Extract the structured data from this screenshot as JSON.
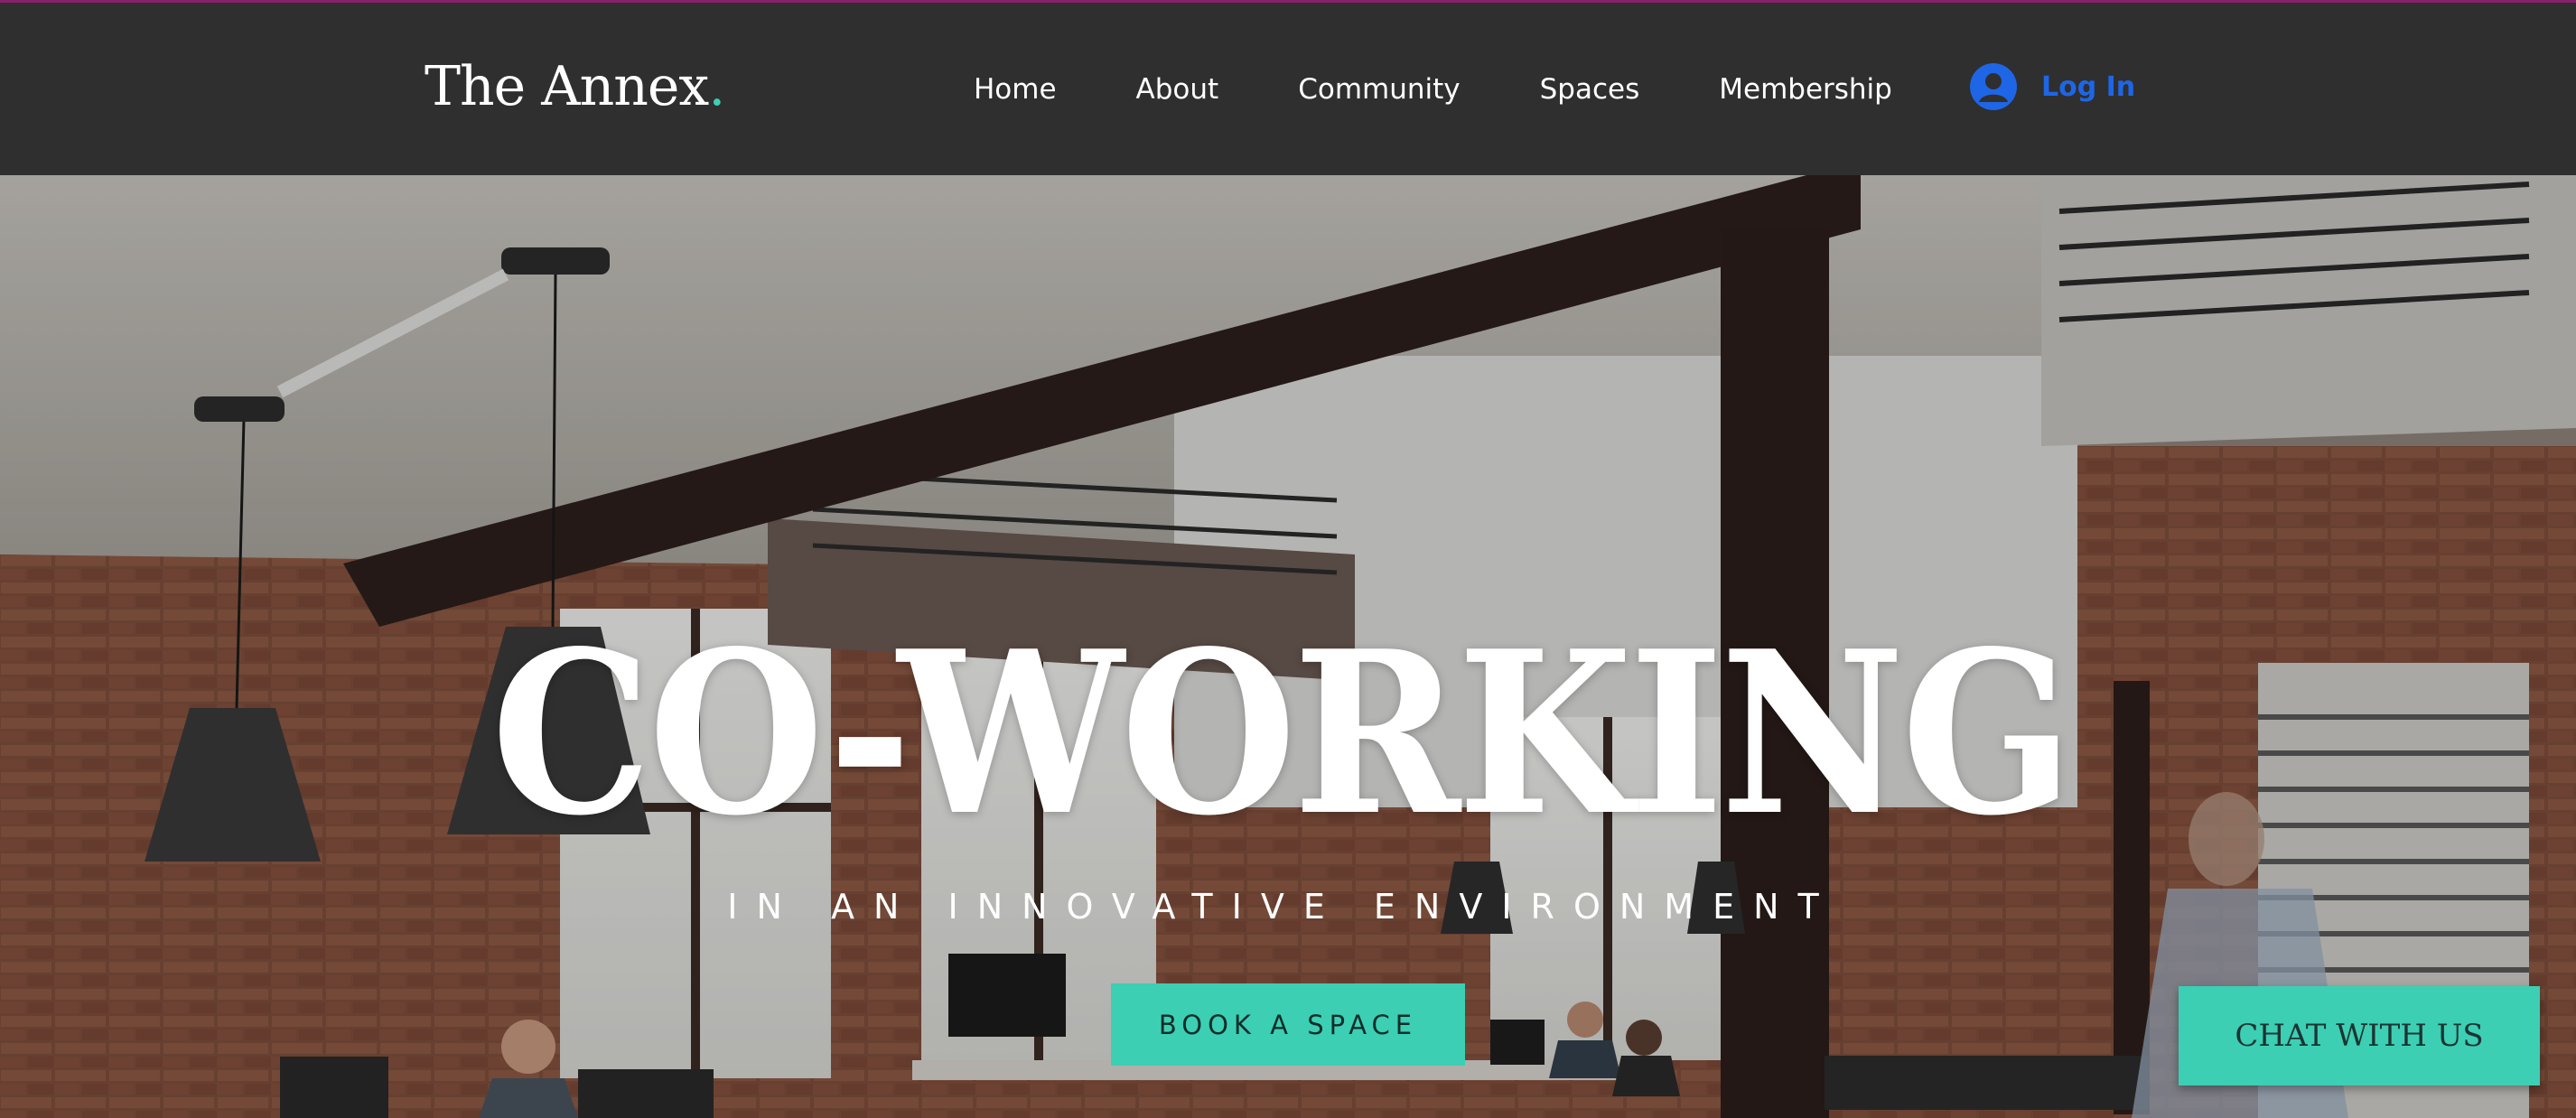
{
  "header": {
    "logo_text": "The Annex",
    "logo_dot": ".",
    "nav": [
      "Home",
      "About",
      "Community",
      "Spaces",
      "Membership"
    ],
    "login_label": "Log In",
    "accent": "#3ccfb4",
    "login_color": "#1e66e6",
    "background": "#2f2f2f"
  },
  "hero": {
    "title": "CO-WORKING",
    "subtitle": "IN AN INNOVATIVE ENVIRONMENT",
    "cta_label": "BOOK A SPACE",
    "image_description_icon": "coworking-loft-photo"
  },
  "chat": {
    "label": "CHAT WITH US"
  }
}
